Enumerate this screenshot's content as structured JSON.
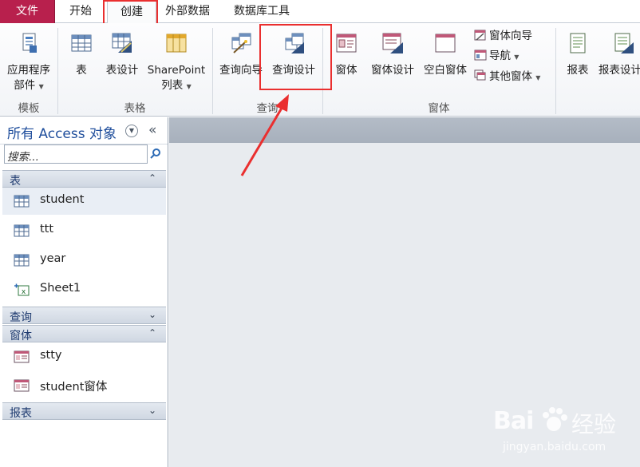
{
  "tabs": [
    {
      "label": "文件",
      "state": "file"
    },
    {
      "label": "开始",
      "state": "normal"
    },
    {
      "label": "创建",
      "state": "active"
    },
    {
      "label": "外部数据",
      "state": "normal"
    },
    {
      "label": "数据库工具",
      "state": "normal"
    }
  ],
  "ribbon": {
    "templates": {
      "app_parts_line1": "应用程序",
      "app_parts_line2": "部件",
      "group": "模板"
    },
    "tables": {
      "table": "表",
      "table_design": "表设计",
      "sharepoint_line1": "SharePoint",
      "sharepoint_line2": "列表",
      "group": "表格"
    },
    "queries": {
      "query_wizard": "查询向导",
      "query_design": "查询设计",
      "group": "查询"
    },
    "forms": {
      "form": "窗体",
      "form_design": "窗体设计",
      "blank_form": "空白窗体",
      "form_wizard": "窗体向导",
      "navigation": "导航",
      "more_forms": "其他窗体",
      "group": "窗体"
    },
    "reports": {
      "report": "报表",
      "report_design": "报表设计"
    }
  },
  "nav": {
    "title": "所有 Access 对象",
    "search_placeholder": "搜索...",
    "sections": {
      "tables": {
        "label": "表",
        "items": [
          "student",
          "ttt",
          "year",
          "Sheet1"
        ]
      },
      "queries": {
        "label": "查询"
      },
      "forms": {
        "label": "窗体",
        "items": [
          "stty",
          "student窗体"
        ]
      },
      "reports": {
        "label": "报表"
      }
    }
  },
  "watermark": {
    "brand": "Bai",
    "brand2": "经验",
    "url": "jingyan.baidu.com"
  },
  "colors": {
    "file_tab": "#b8204d",
    "highlight": "#ea2f2f",
    "nav_title": "#1f4e9c"
  }
}
